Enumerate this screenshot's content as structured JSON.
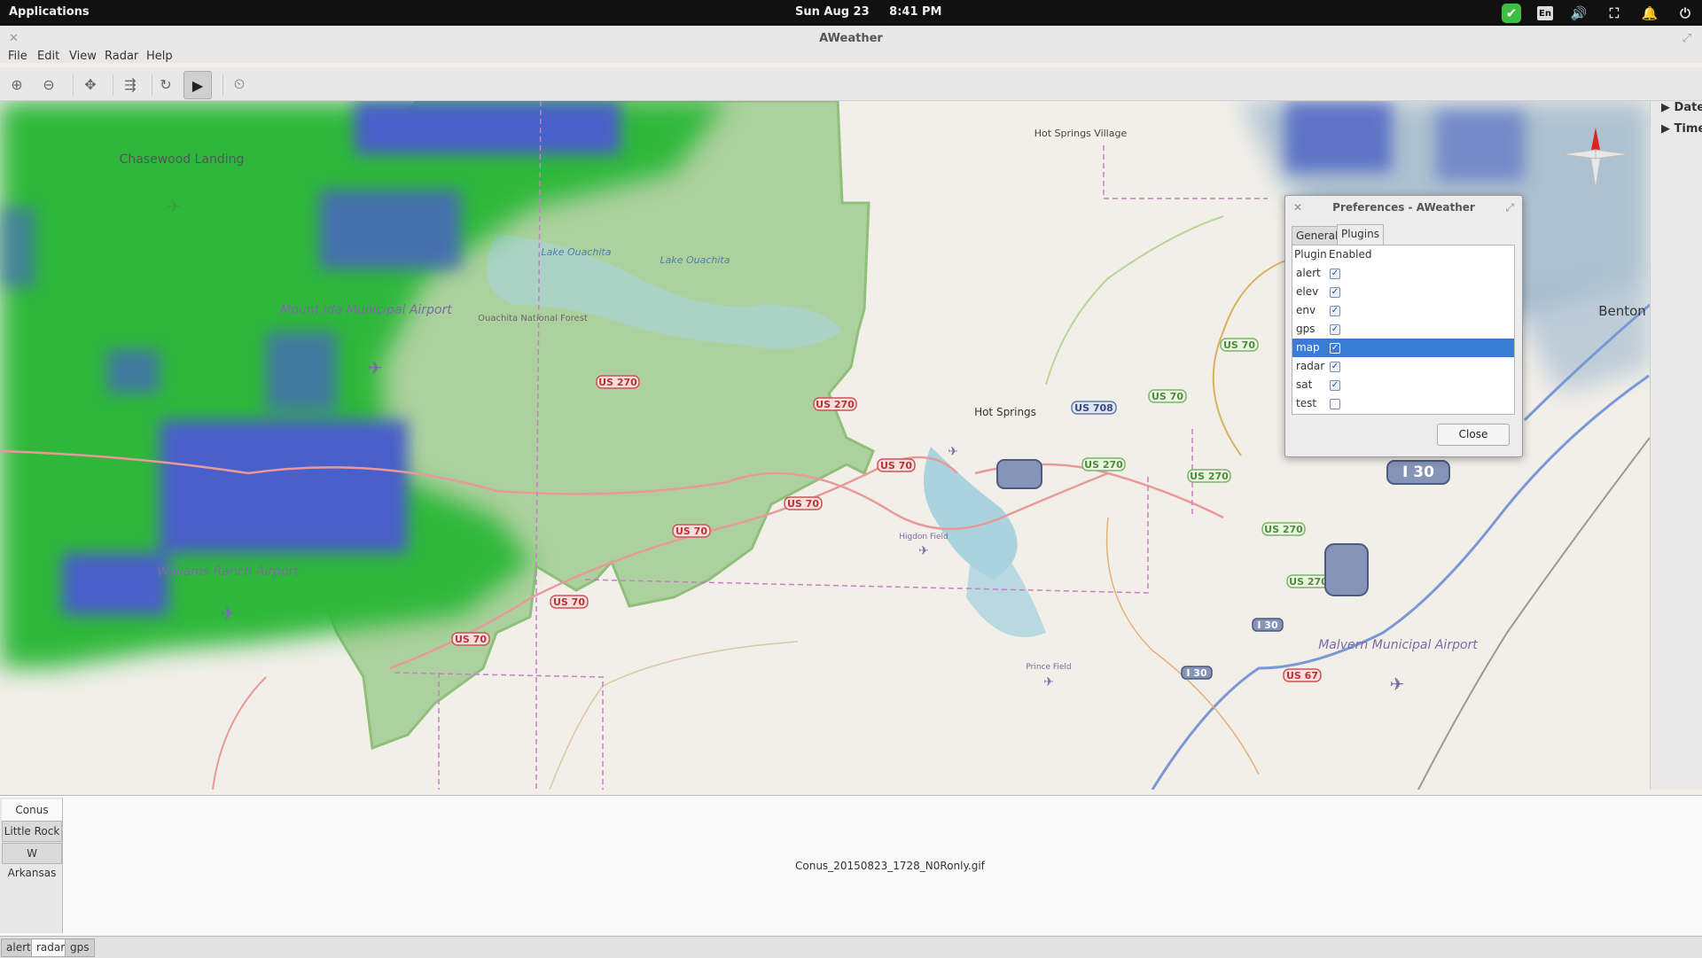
{
  "topbar": {
    "applications": "Applications",
    "date": "Sun Aug 23",
    "time": "8:41 PM",
    "lang": "En"
  },
  "window": {
    "title": "AWeather"
  },
  "menu": [
    "File",
    "Edit",
    "View",
    "Radar",
    "Help"
  ],
  "side_panel": {
    "date": "Date",
    "time": "Time"
  },
  "map": {
    "places": [
      "Chasewood Landing",
      "Mount Ida Municipal Airport",
      "Williams Ranch Airport",
      "Lake Ouachita",
      "Lake Ouachita",
      "Ouachita National Forest",
      "Hot Springs Village",
      "Hot Springs",
      "Higdon Field",
      "Prince Field",
      "Malvern Municipal Airport",
      "Benton"
    ],
    "roads": [
      "US 270",
      "US 270",
      "US 70",
      "US 70",
      "US 70",
      "US 70",
      "US 70",
      "US 70",
      "US 70",
      "US 708",
      "US 270",
      "US 270",
      "US 270",
      "US 270",
      "I 30",
      "I 30",
      "I 30",
      "US 67"
    ]
  },
  "dialog": {
    "title": "Preferences - AWeather",
    "tabs": [
      "General",
      "Plugins"
    ],
    "active_tab": "Plugins",
    "col_plugin": "Plugin",
    "col_enabled": "Enabled",
    "plugins": [
      {
        "name": "alert",
        "enabled": true
      },
      {
        "name": "elev",
        "enabled": true
      },
      {
        "name": "env",
        "enabled": true
      },
      {
        "name": "gps",
        "enabled": true
      },
      {
        "name": "map",
        "enabled": true
      },
      {
        "name": "radar",
        "enabled": true
      },
      {
        "name": "sat",
        "enabled": true
      },
      {
        "name": "test",
        "enabled": false
      }
    ],
    "selected": "map",
    "close_label": "Close"
  },
  "radar_panel": {
    "sites": [
      "Conus",
      "Little Rock",
      "W Arkansas"
    ],
    "active_site": "Conus",
    "image_file": "Conus_20150823_1728_N0Ronly.gif"
  },
  "bottom_tabs": [
    "alert",
    "radar",
    "gps"
  ],
  "active_bottom_tab": "radar"
}
